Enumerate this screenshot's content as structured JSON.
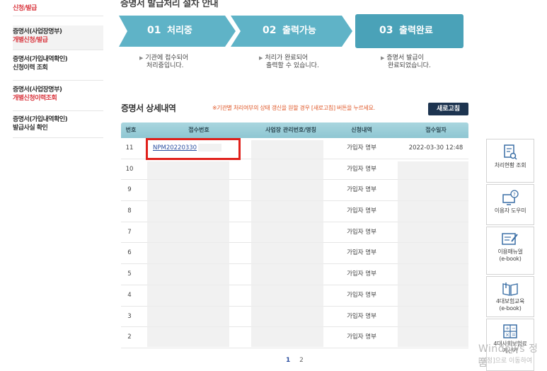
{
  "sidebar": {
    "items": [
      {
        "line1": "",
        "line2": "신청/발급",
        "style": "red"
      },
      {
        "line1": "증명서(사업장명부)",
        "line2": "개별신청/발급",
        "style": "red"
      },
      {
        "line1": "증명서(가입내역확인)",
        "line2": "신청이력 조회",
        "style": "dark"
      },
      {
        "line1": "증명서(사업장명부)",
        "line2": "개별신청이력조회",
        "style": "red"
      },
      {
        "line1": "증명서(가입내역확인)",
        "line2": "발급사실 확인",
        "style": "dark"
      }
    ]
  },
  "page": {
    "title": "증명서 발급처리 절차 안내"
  },
  "steps": [
    {
      "num": "01",
      "label": "처리중",
      "desc1": "기관에 접수되어",
      "desc2": "처리중입니다."
    },
    {
      "num": "02",
      "label": "출력가능",
      "desc1": "처리가 완료되어",
      "desc2": "출력할 수 있습니다."
    },
    {
      "num": "03",
      "label": "출력완료",
      "desc1": "증명서 발급이",
      "desc2": "완료되었습니다."
    }
  ],
  "section": {
    "title": "증명서 상세내역",
    "note": "※기관별 처리여부의 상태 갱신을 원할 경우 [새로고침] 버튼을 누르세요.",
    "refresh_label": "새로고침"
  },
  "table": {
    "headers": [
      "번호",
      "접수번호",
      "사업장 관리번호/명칭",
      "신청내역",
      "접수일자"
    ],
    "rows": [
      {
        "no": "11",
        "receipt": "NPM20220330",
        "type": "가입자 명부",
        "date": "2022-03-30  12:48"
      },
      {
        "no": "10",
        "receipt": "",
        "type": "가입자 명부",
        "date": ""
      },
      {
        "no": "9",
        "receipt": "",
        "type": "가입자 명부",
        "date": ""
      },
      {
        "no": "8",
        "receipt": "",
        "type": "가입자 명부",
        "date": ""
      },
      {
        "no": "7",
        "receipt": "",
        "type": "가입자 명부",
        "date": ""
      },
      {
        "no": "6",
        "receipt": "",
        "type": "가입자 명부",
        "date": ""
      },
      {
        "no": "5",
        "receipt": "",
        "type": "가입자 명부",
        "date": ""
      },
      {
        "no": "4",
        "receipt": "",
        "type": "가입자 명부",
        "date": ""
      },
      {
        "no": "3",
        "receipt": "",
        "type": "가입자 명부",
        "date": ""
      },
      {
        "no": "2",
        "receipt": "",
        "type": "가입자 명부",
        "date": ""
      }
    ]
  },
  "pagination": {
    "current": "1",
    "next": "2"
  },
  "quick_menu": [
    {
      "icon": "document-search-icon",
      "label1": "처리현황 조회",
      "label2": ""
    },
    {
      "icon": "help-monitor-icon",
      "label1": "이용자 도우미",
      "label2": ""
    },
    {
      "icon": "edit-manual-icon",
      "label1": "이용매뉴얼",
      "label2": "(e-book)"
    },
    {
      "icon": "book-icon",
      "label1": "4대보험교육",
      "label2": "(e-book)"
    },
    {
      "icon": "calculator-icon",
      "label1": "4대사회보험료",
      "label2": "계산기"
    }
  ],
  "watermark": {
    "line1": "Windows 정품",
    "line2": "[설정]으로 이동하여"
  },
  "colors": {
    "step_fill": "#5fb3c7",
    "step_last": "#4aa2b8",
    "header_fill": "#9ccfd9",
    "highlight": "#e0201b",
    "button": "#1d3450"
  }
}
